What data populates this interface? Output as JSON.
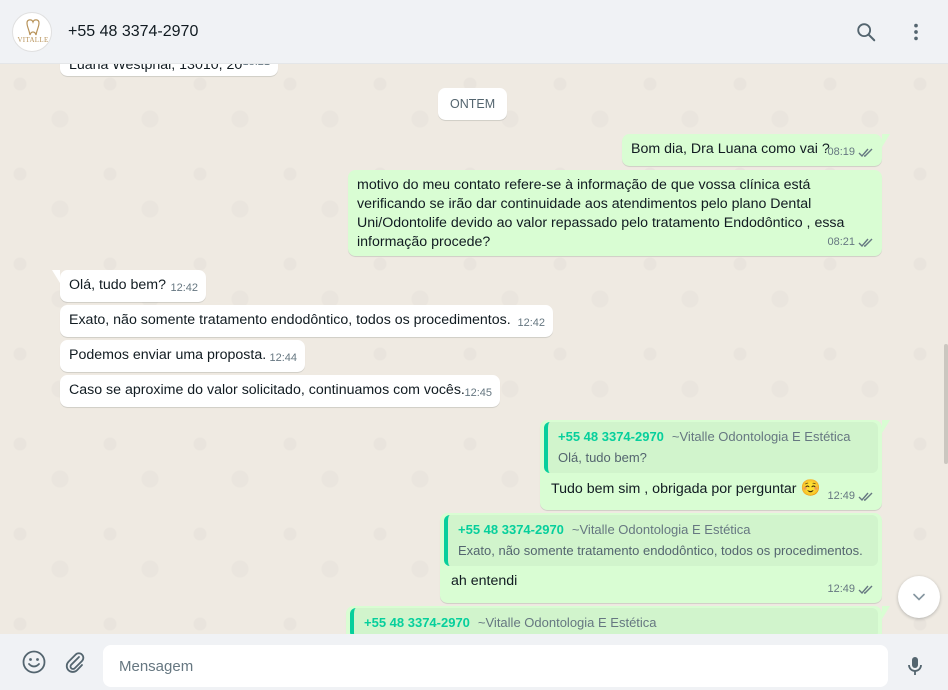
{
  "header": {
    "contact_name": "+55 48 3374-2970",
    "avatar_logo_text": "VITALLE",
    "search_icon": "search-icon",
    "menu_icon": "kebab-menu-icon"
  },
  "chat": {
    "top_partial": {
      "text": "Luana Westphal, 13010, 20",
      "time": "18:21"
    },
    "date_separator": "ONTEM",
    "messages": [
      {
        "dir": "out",
        "text": "Bom dia, Dra Luana como vai ?",
        "time": "08:19"
      },
      {
        "dir": "out",
        "text": "motivo do meu contato refere-se à informação de que vossa clínica está verificando se irão dar continuidade aos atendimentos pelo plano Dental Uni/Odontolife devido ao valor repassado pelo tratamento Endodôntico , essa informação procede?",
        "time": "08:21"
      },
      {
        "dir": "in",
        "text": "Olá, tudo bem?",
        "time": "12:42"
      },
      {
        "dir": "in",
        "text": "Exato, não somente tratamento endodôntico, todos os procedimentos.",
        "time": "12:42"
      },
      {
        "dir": "in",
        "text": "Podemos enviar uma proposta.",
        "time": "12:44"
      },
      {
        "dir": "in",
        "text": "Caso se aproxime do valor solicitado, continuamos com vocês.",
        "time": "12:45"
      },
      {
        "dir": "out",
        "quote_author": "+55 48 3374-2970",
        "quote_sub": "~Vitalle Odontologia E Estética",
        "quote_text": "Olá, tudo bem?",
        "text": "Tudo bem sim , obrigada por perguntar",
        "emoji": "☺️",
        "time": "12:49"
      },
      {
        "dir": "out",
        "quote_author": "+55 48 3374-2970",
        "quote_sub": "~Vitalle Odontologia E Estética",
        "quote_text": "Exato, não somente tratamento endodôntico, todos os procedimentos.",
        "text": "ah entendi",
        "time": "12:49"
      },
      {
        "dir": "out",
        "quote_author": "+55 48 3374-2970",
        "quote_sub": "~Vitalle Odontologia E Estética",
        "quote_text": "",
        "text": "",
        "time": ""
      }
    ]
  },
  "composer": {
    "placeholder": "Mensagem",
    "emoji_icon": "emoji-icon",
    "attach_icon": "paperclip-icon",
    "mic_icon": "microphone-icon"
  },
  "colors": {
    "header_bg": "#f0f2f5",
    "chat_bg": "#efeae2",
    "outgoing_bubble": "#d9fdd3",
    "incoming_bubble": "#ffffff",
    "quote_accent": "#06cf9c",
    "read_tick": "#667781"
  }
}
